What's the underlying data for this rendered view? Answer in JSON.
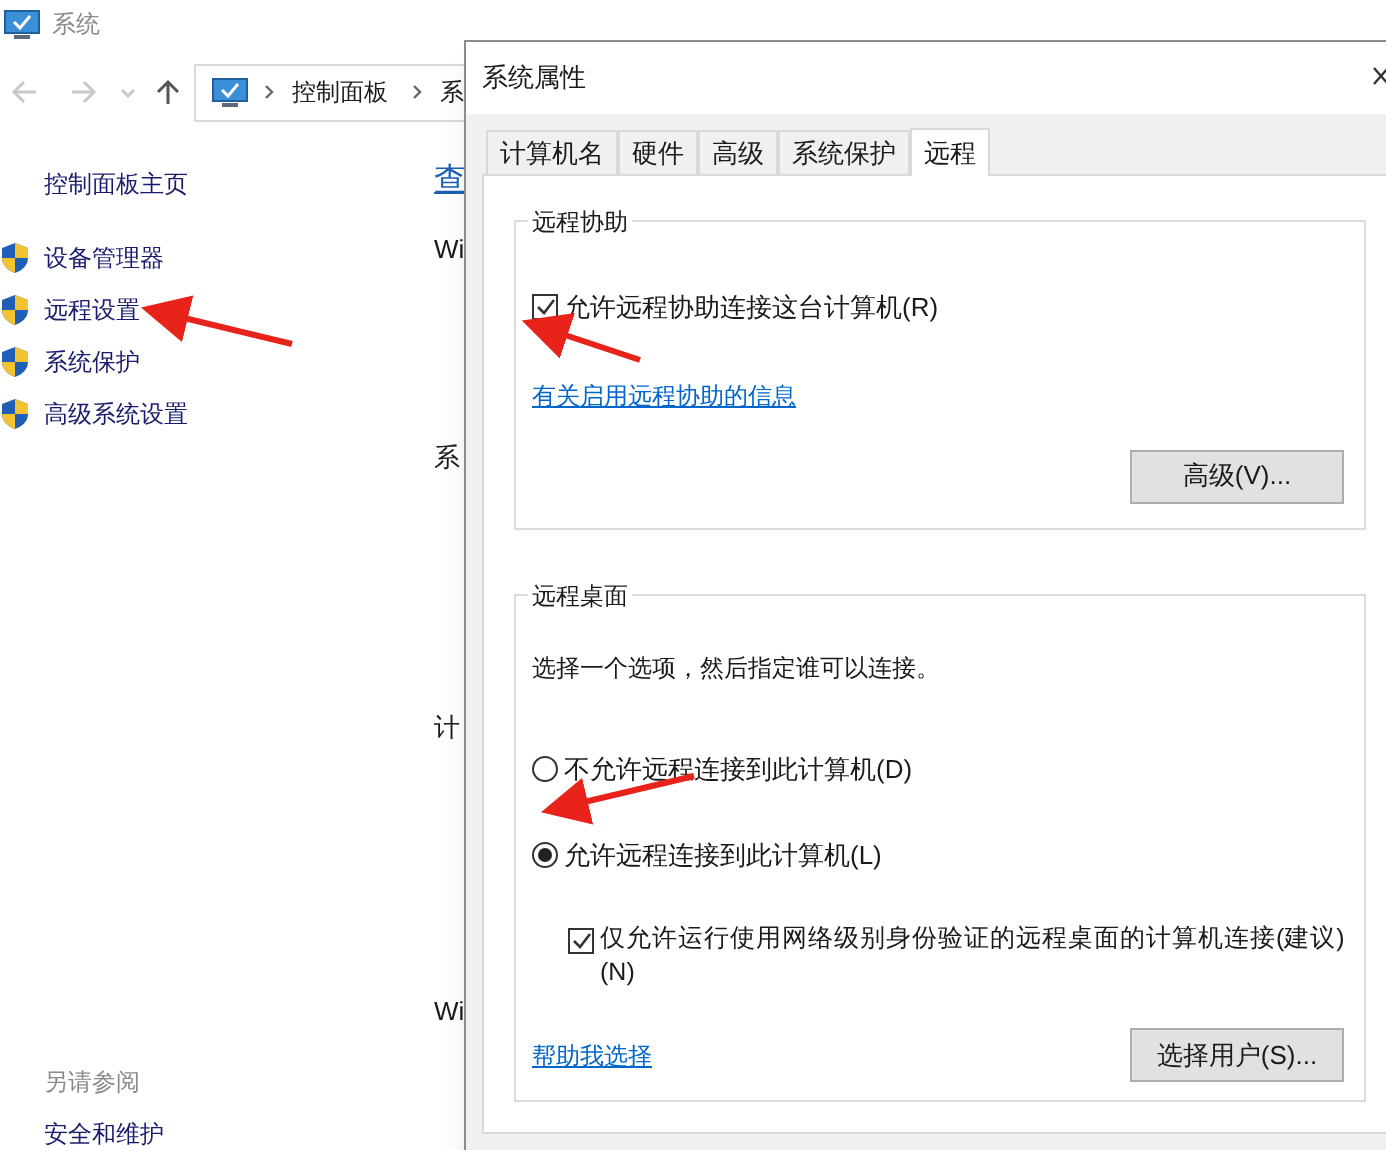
{
  "background_window": {
    "title": "系统",
    "breadcrumb": [
      "控制面板",
      "系"
    ],
    "sidebar": {
      "home_link": "控制面板主页",
      "items": [
        "设备管理器",
        "远程设置",
        "系统保护",
        "高级系统设置"
      ],
      "see_also": {
        "heading": "另请参阅",
        "items": [
          "安全和维护"
        ]
      }
    },
    "content_fragments": [
      {
        "kind": "link",
        "text": "查"
      },
      {
        "kind": "text",
        "text": "Wi"
      },
      {
        "kind": "text",
        "text": "系"
      },
      {
        "kind": "text",
        "text": "计"
      },
      {
        "kind": "text",
        "text": "Wi"
      }
    ]
  },
  "dialog": {
    "title": "系统属性",
    "tabs": [
      {
        "label": "计算机名",
        "selected": false
      },
      {
        "label": "硬件",
        "selected": false
      },
      {
        "label": "高级",
        "selected": false
      },
      {
        "label": "系统保护",
        "selected": false
      },
      {
        "label": "远程",
        "selected": true
      }
    ],
    "remote_assistance": {
      "legend": "远程协助",
      "allow": {
        "label": "允许远程协助连接这台计算机(R)",
        "checked": true
      },
      "info_link": "有关启用远程协助的信息",
      "advanced_button": "高级(V)..."
    },
    "remote_desktop": {
      "legend": "远程桌面",
      "instruction": "选择一个选项，然后指定谁可以连接。",
      "options": [
        {
          "label": "不允许远程连接到此计算机(D)",
          "selected": false
        },
        {
          "label": "允许远程连接到此计算机(L)",
          "selected": true
        }
      ],
      "nla": {
        "label": "仅允许运行使用网络级别身份验证的远程桌面的计算机连接(建议)(N)",
        "checked": true
      },
      "help_link": "帮助我选择",
      "select_users_button": "选择用户(S)..."
    }
  }
}
